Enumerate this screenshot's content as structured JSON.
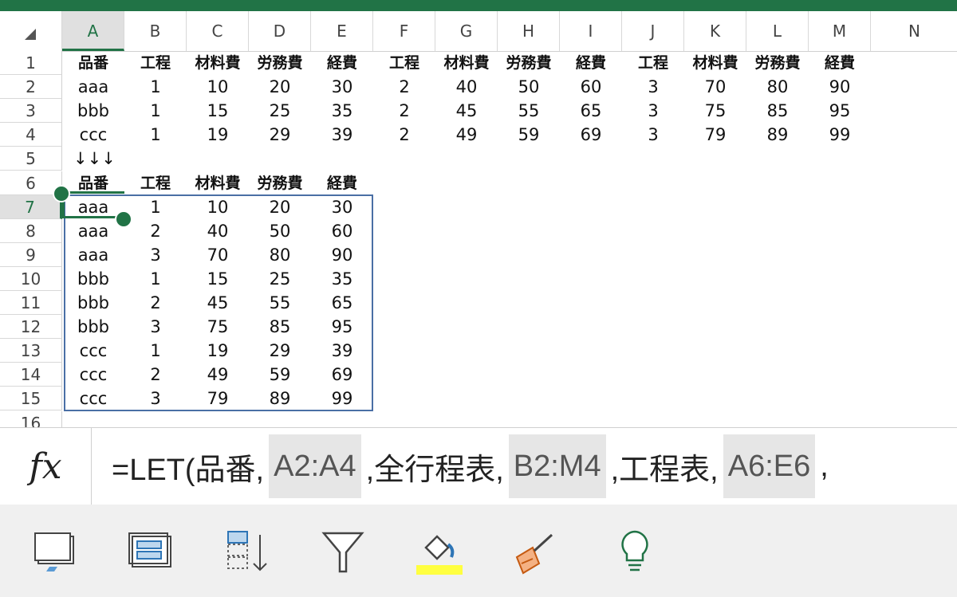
{
  "columns": [
    "A",
    "B",
    "C",
    "D",
    "E",
    "F",
    "G",
    "H",
    "I",
    "J",
    "K",
    "L",
    "M",
    "N"
  ],
  "selected_column": "A",
  "rows": [
    "1",
    "2",
    "3",
    "4",
    "5",
    "6",
    "7",
    "8",
    "9",
    "10",
    "11",
    "12",
    "13",
    "14",
    "15",
    "16"
  ],
  "selected_row": "7",
  "sheet": {
    "r1": [
      "品番",
      "工程",
      "材料費",
      "労務費",
      "経費",
      "工程",
      "材料費",
      "労務費",
      "経費",
      "工程",
      "材料費",
      "労務費",
      "経費"
    ],
    "r2": [
      "aaa",
      "1",
      "10",
      "20",
      "30",
      "2",
      "40",
      "50",
      "60",
      "3",
      "70",
      "80",
      "90"
    ],
    "r3": [
      "bbb",
      "1",
      "15",
      "25",
      "35",
      "2",
      "45",
      "55",
      "65",
      "3",
      "75",
      "85",
      "95"
    ],
    "r4": [
      "ccc",
      "1",
      "19",
      "29",
      "39",
      "2",
      "49",
      "59",
      "69",
      "3",
      "79",
      "89",
      "99"
    ],
    "r5": [
      "↓↓↓"
    ],
    "r6": [
      "品番",
      "工程",
      "材料費",
      "労務費",
      "経費"
    ],
    "r7": [
      "aaa",
      "1",
      "10",
      "20",
      "30"
    ],
    "r8": [
      "aaa",
      "2",
      "40",
      "50",
      "60"
    ],
    "r9": [
      "aaa",
      "3",
      "70",
      "80",
      "90"
    ],
    "r10": [
      "bbb",
      "1",
      "15",
      "25",
      "35"
    ],
    "r11": [
      "bbb",
      "2",
      "45",
      "55",
      "65"
    ],
    "r12": [
      "bbb",
      "3",
      "75",
      "85",
      "95"
    ],
    "r13": [
      "ccc",
      "1",
      "19",
      "29",
      "39"
    ],
    "r14": [
      "ccc",
      "2",
      "49",
      "59",
      "69"
    ],
    "r15": [
      "ccc",
      "3",
      "79",
      "89",
      "99"
    ]
  },
  "formula_bar": {
    "fx_label": "fx",
    "parts": [
      {
        "text": "=LET(品番,",
        "ref": false
      },
      {
        "text": "A2:A4",
        "ref": true
      },
      {
        "text": ",全行程表,",
        "ref": false
      },
      {
        "text": "B2:M4",
        "ref": true
      },
      {
        "text": ",工程表,",
        "ref": false
      },
      {
        "text": "A6:E6",
        "ref": true
      },
      {
        "text": ",",
        "ref": false
      }
    ]
  },
  "toolbar": {
    "items": [
      "freeze-panes-icon",
      "table-style-icon",
      "sort-icon",
      "filter-icon",
      "fill-color-icon",
      "clear-format-icon",
      "ideas-icon"
    ]
  },
  "colors": {
    "accent": "#217346",
    "table_border": "#4a6fa5",
    "fill_highlight": "#ffff00"
  }
}
